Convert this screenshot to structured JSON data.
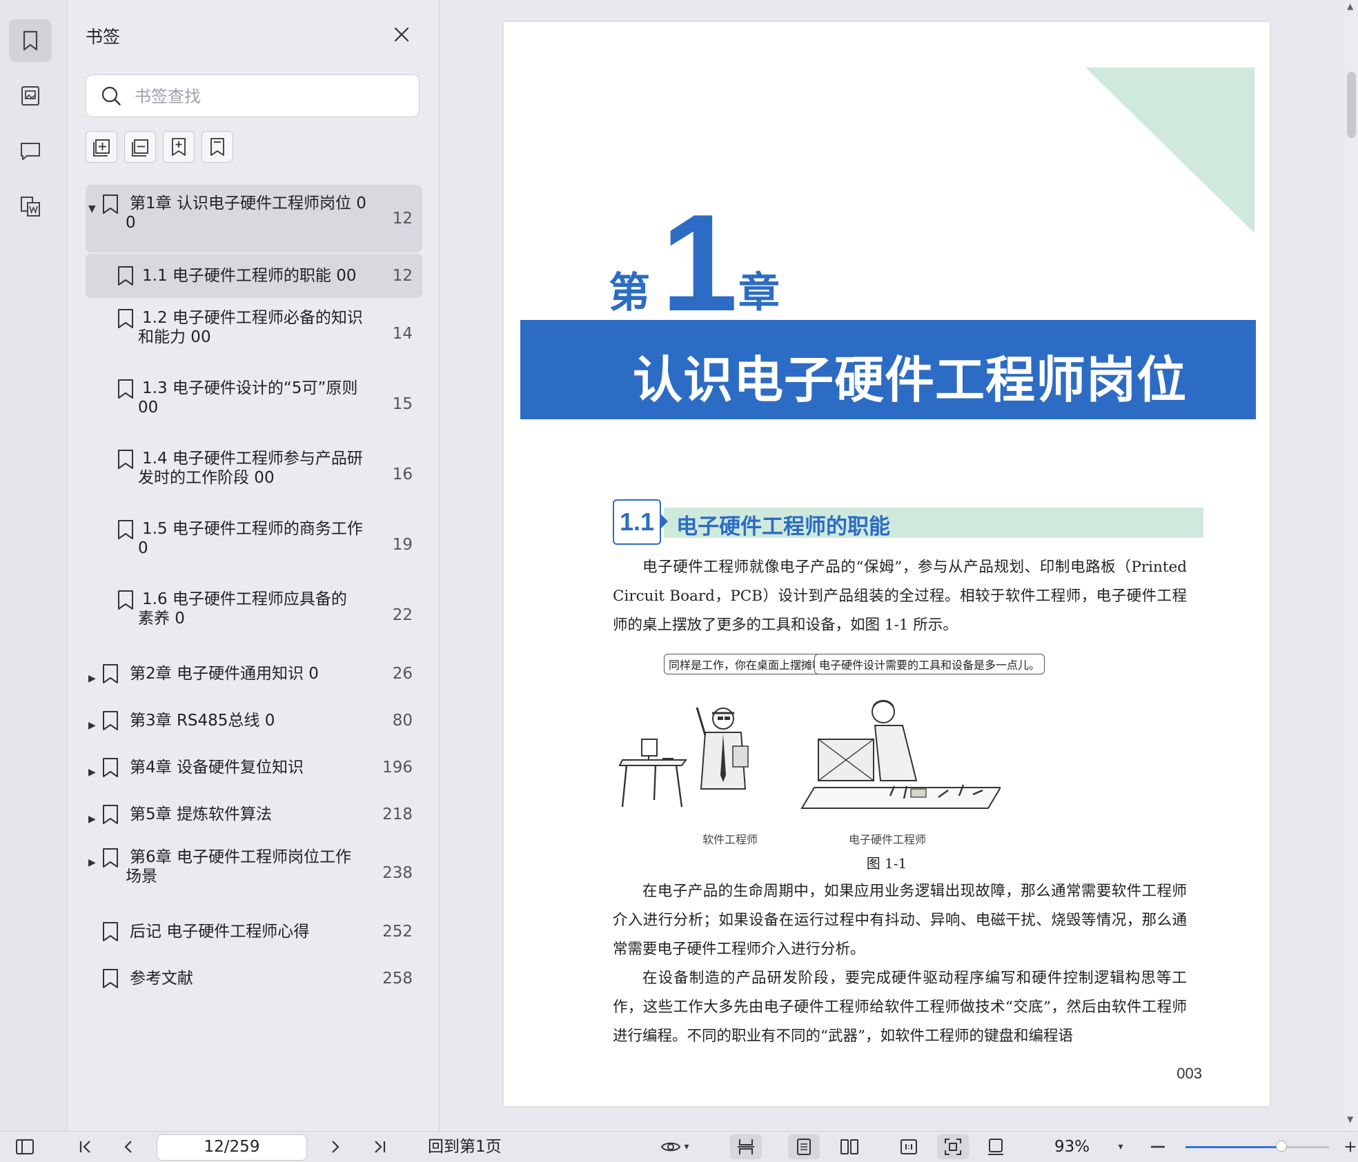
{
  "panel": {
    "title": "书签",
    "search_placeholder": "书签查找"
  },
  "bookmarks": [
    {
      "caret": "▼",
      "line1": "第1章  认识电子硬件工程师岗位 0",
      "line2": "0",
      "page": "12"
    },
    {
      "line1": "1.1  电子硬件工程师的职能 00",
      "page": "12"
    },
    {
      "line1": "1.2  电子硬件工程师必备的知识",
      "line2": "和能力 00",
      "page": "14"
    },
    {
      "line1": "1.3  电子硬件设计的“5可”原则",
      "line2": "00",
      "page": "15"
    },
    {
      "line1": "1.4  电子硬件工程师参与产品研",
      "line2": "发时的工作阶段 00",
      "page": "16"
    },
    {
      "line1": "1.5  电子硬件工程师的商务工作",
      "line2": "0",
      "page": "19"
    },
    {
      "line1": "1.6  电子硬件工程师应具备的",
      "line2": "素养 0",
      "page": "22"
    },
    {
      "caret": "▶",
      "line1": "第2章  电子硬件通用知识 0",
      "page": "26"
    },
    {
      "caret": "▶",
      "line1": "第3章  RS485总线 0",
      "page": "80"
    },
    {
      "caret": "▶",
      "line1": "第4章  设备硬件复位知识",
      "page": "196"
    },
    {
      "caret": "▶",
      "line1": "第5章  提炼软件算法",
      "page": "218"
    },
    {
      "caret": "▶",
      "line1": "第6章  电子硬件工程师岗位工作",
      "line2": "场景",
      "page": "238"
    },
    {
      "line1": "后记  电子硬件工程师心得",
      "page": "252"
    },
    {
      "line1": "参考文献",
      "page": "258"
    }
  ],
  "doc": {
    "chapter_di": "第",
    "chapter_num": "1",
    "chapter_zhang": "章",
    "chapter_title": "认识电子硬件工程师岗位",
    "section_num": "1.1",
    "section_title": "电子硬件工程师的职能",
    "para1": "电子硬件工程师就像电子产品的“保姆”，参与从产品规划、印制电路板（Printed Circuit Board，PCB）设计到产品组装的全过程。相较于软件工程师，电子硬件工程师的桌上摆放了更多的工具和设备，如图 1-1 所示。",
    "bubble1": "同样是工作，你在桌面上摆摊呢?",
    "bubble2": "电子硬件设计需要的工具和设备是多一点儿。",
    "label_sw": "软件工程师",
    "label_hw": "电子硬件工程师",
    "figure_caption": "图 1-1",
    "para2": "在电子产品的生命周期中，如果应用业务逻辑出现故障，那么通常需要软件工程师介入进行分析；如果设备在运行过程中有抖动、异响、电磁干扰、烧毁等情况，那么通常需要电子硬件工程师介入进行分析。",
    "para3": "在设备制造的产品研发阶段，要完成硬件驱动程序编写和硬件控制逻辑构思等工作，这些工作大多先由电子硬件工程师给软件工程师做技术“交底”，然后由软件工程师进行编程。不同的职业有不同的“武器”，如软件工程师的键盘和编程语",
    "page_number": "003"
  },
  "toolbar": {
    "page_indicator": "12/259",
    "goto_first": "回到第1页",
    "zoom": "93%",
    "zoom_slider_fraction": 0.67
  },
  "colors": {
    "accent_blue": "#2c6cc4",
    "mint": "#cfe9dc",
    "slider_blue": "#2f72dc"
  }
}
